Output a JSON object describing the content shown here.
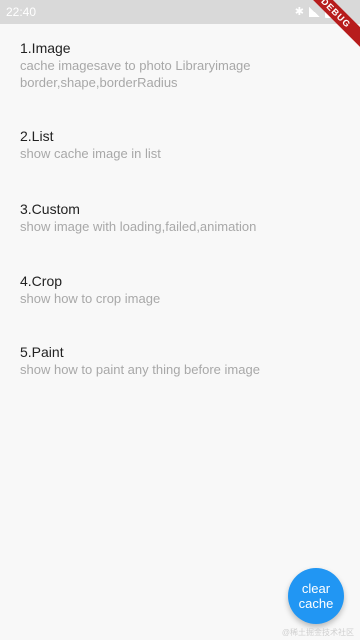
{
  "status_bar": {
    "time": "22:40",
    "debug_label": "DEBUG",
    "icons": [
      "bluetooth-icon",
      "signal-icon",
      "battery-icon"
    ]
  },
  "menu": {
    "items": [
      {
        "title": "1.Image",
        "lines": [
          "cache imagesave to photo Libraryimage",
          "border,shape,borderRadius"
        ]
      },
      {
        "title": "2.List",
        "lines": [
          "show cache image in list"
        ]
      },
      {
        "title": "3.Custom",
        "lines": [
          "show image with loading,failed,animation"
        ]
      },
      {
        "title": "4.Crop",
        "lines": [
          "show how to crop image"
        ]
      },
      {
        "title": "5.Paint",
        "lines": [
          "show how to paint any thing before image"
        ]
      }
    ]
  },
  "fab": {
    "line1": "clear",
    "line2": "cache"
  },
  "watermark": "@稀土掘金技术社区",
  "colors": {
    "accent": "#2196f3",
    "title": "#222222",
    "subtitle": "#a8a8a8",
    "background": "#f8f8f8"
  }
}
